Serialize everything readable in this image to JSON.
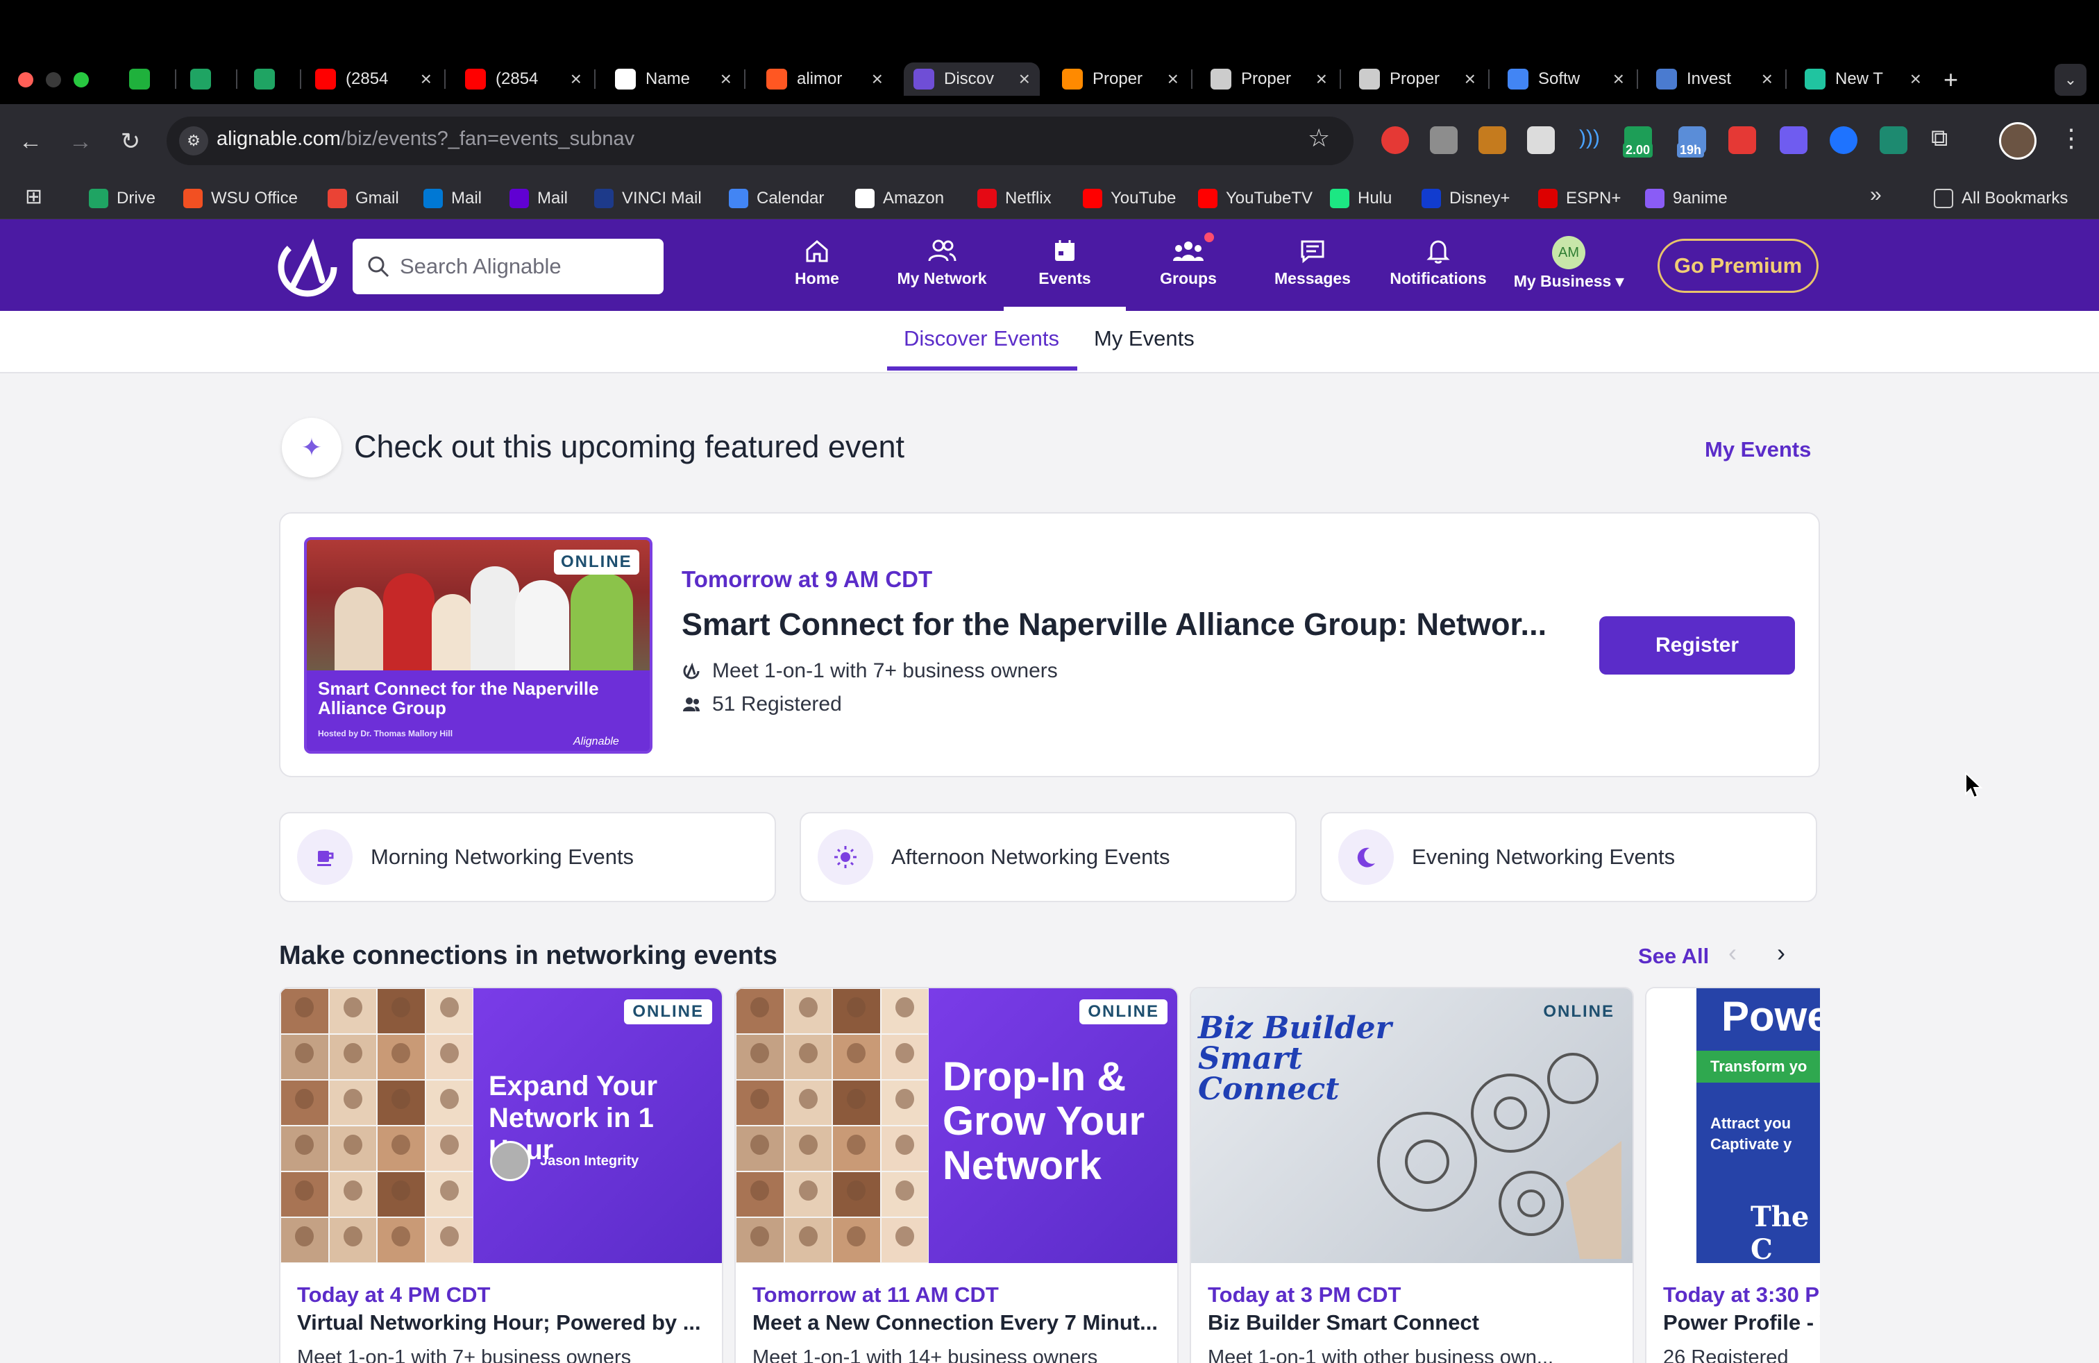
{
  "browser": {
    "tabs": [
      {
        "title": "",
        "favicon_color": "#1fb13c"
      },
      {
        "title": "",
        "favicon_color": "#1fa463"
      },
      {
        "title": "",
        "favicon_color": "#1fa463"
      },
      {
        "title": "(2854",
        "favicon_color": "#ff0000"
      },
      {
        "title": "(2854",
        "favicon_color": "#ff0000"
      },
      {
        "title": "Name",
        "favicon_color": "#ffffff"
      },
      {
        "title": "alimor",
        "favicon_color": "#ff5722"
      },
      {
        "title": "Discov",
        "favicon_color": "#6f4ed6"
      },
      {
        "title": "Proper",
        "favicon_color": "#ff8a00"
      },
      {
        "title": "Proper",
        "favicon_color": "#cccccc"
      },
      {
        "title": "Proper",
        "favicon_color": "#cccccc"
      },
      {
        "title": "Softw",
        "favicon_color": "#4285f4"
      },
      {
        "title": "Invest",
        "favicon_color": "#4a7bd0"
      },
      {
        "title": "New T",
        "favicon_color": "#20c4a0"
      }
    ],
    "url_host": "alignable.com",
    "url_path": "/biz/events?_fan=events_subnav",
    "extension_badges": [
      "2.00",
      "19h"
    ],
    "bookmarks": [
      {
        "label": "Drive",
        "color": "#1fa463"
      },
      {
        "label": "WSU Office",
        "color": "#f25022"
      },
      {
        "label": "Gmail",
        "color": "#ea4335"
      },
      {
        "label": "Mail",
        "color": "#0078d4"
      },
      {
        "label": "Mail",
        "color": "#6001d2"
      },
      {
        "label": "VINCI Mail",
        "color": "#1d3a8a"
      },
      {
        "label": "Calendar",
        "color": "#4285f4"
      },
      {
        "label": "Amazon",
        "color": "#ffffff"
      },
      {
        "label": "Netflix",
        "color": "#e50914"
      },
      {
        "label": "YouTube",
        "color": "#ff0000"
      },
      {
        "label": "YouTubeTV",
        "color": "#ff0000"
      },
      {
        "label": "Hulu",
        "color": "#1ce783"
      },
      {
        "label": "Disney+",
        "color": "#113ccf"
      },
      {
        "label": "ESPN+",
        "color": "#d00"
      },
      {
        "label": "9anime",
        "color": "#8a5cf6"
      }
    ],
    "more_bookmarks": "»",
    "all_bookmarks": "All Bookmarks"
  },
  "header": {
    "search_placeholder": "Search Alignable",
    "nav": [
      {
        "label": "Home",
        "icon": "home-icon"
      },
      {
        "label": "My Network",
        "icon": "people-icon"
      },
      {
        "label": "Events",
        "icon": "calendar-icon"
      },
      {
        "label": "Groups",
        "icon": "groups-icon"
      },
      {
        "label": "Messages",
        "icon": "message-icon"
      },
      {
        "label": "Notifications",
        "icon": "bell-icon"
      },
      {
        "label": "My Business",
        "icon": "avatar",
        "avatar_initials": "AM"
      }
    ],
    "premium_label": "Go Premium",
    "colors": {
      "brand": "#4b1aa3",
      "accent": "#5b2cc9",
      "premium": "#e9c46a"
    }
  },
  "subnav": {
    "tabs": [
      "Discover Events",
      "My Events"
    ],
    "active": "Discover Events"
  },
  "featured": {
    "heading": "Check out this upcoming featured event",
    "my_events_link": "My Events",
    "badge": "ONLINE",
    "image_title": "Smart Connect for the Naperville Alliance Group",
    "image_host": "Hosted by Dr. Thomas Mallory Hill",
    "image_brand": "Alignable",
    "time": "Tomorrow at 9 AM CDT",
    "name": "Smart Connect for the Naperville Alliance Group: Networ...",
    "meta_meet": "Meet 1-on-1 with 7+ business owners",
    "meta_registered": "51 Registered",
    "register_label": "Register"
  },
  "filters": [
    {
      "label": "Morning Networking Events",
      "icon": "coffee-icon"
    },
    {
      "label": "Afternoon Networking Events",
      "icon": "sun-icon"
    },
    {
      "label": "Evening Networking Events",
      "icon": "moon-icon"
    }
  ],
  "networking": {
    "title": "Make connections in networking events",
    "see_all": "See All",
    "cards": [
      {
        "badge": "ONLINE",
        "image_headline": "Expand Your Network in 1 Hour",
        "image_host": "Jason Integrity",
        "time": "Today at 4 PM CDT",
        "name": "Virtual Networking Hour; Powered by ...",
        "meta": "Meet 1-on-1 with 7+ business owners"
      },
      {
        "badge": "ONLINE",
        "image_headline": "Drop-In & Grow Your Network",
        "time": "Tomorrow at 11 AM CDT",
        "name": "Meet a New Connection Every 7 Minut...",
        "meta": "Meet 1-on-1 with 14+ business owners"
      },
      {
        "badge": "ONLINE",
        "image_headline": "Biz Builder Smart Connect",
        "time": "Today at 3 PM CDT",
        "name": "Biz Builder Smart Connect",
        "meta": "Meet 1-on-1 with other business own..."
      },
      {
        "image_headline": "Powe",
        "image_banner": "Transform yo",
        "image_sub": "Attract you Captivate y",
        "image_footer": "The C",
        "time": "Today at 3:30 P",
        "name": "Power Profile - T",
        "meta": "26 Registered"
      }
    ]
  }
}
